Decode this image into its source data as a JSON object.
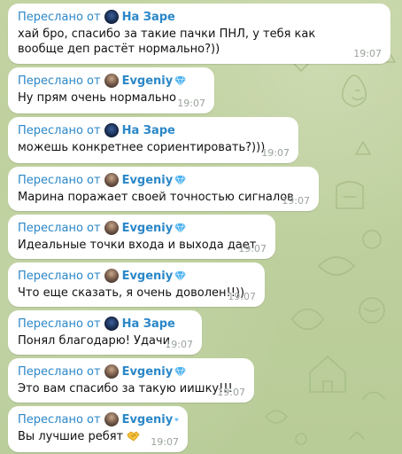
{
  "forward_prefix": "Переслано от",
  "messages": [
    {
      "sender": "На Заре",
      "avatar": "na-zare-avatar",
      "text": "хай бро, спасибо за такие пачки ПНЛ, у тебя как вообще деп растёт нормально?))",
      "time": "19:07"
    },
    {
      "sender": "Evgeniy",
      "avatar": "evgeniy-avatar",
      "text": "Ну прям очень нормально",
      "time": "19:07"
    },
    {
      "sender": "На Заре",
      "avatar": "na-zare-avatar",
      "text": "можешь конкретнее сориентировать?)))",
      "time": "19:07"
    },
    {
      "sender": "Evgeniy",
      "avatar": "evgeniy-avatar",
      "text": "Марина поражает своей точностью сигналов",
      "time": "19:07"
    },
    {
      "sender": "Evgeniy",
      "avatar": "evgeniy-avatar",
      "text": "Идеальные точки входа и выхода дает",
      "time": "19:07"
    },
    {
      "sender": "Evgeniy",
      "avatar": "evgeniy-avatar",
      "text": "Что еще сказать, я очень доволен!!))",
      "time": "19:07"
    },
    {
      "sender": "На Заре",
      "avatar": "na-zare-avatar",
      "text": "Понял благодарю! Удачи",
      "time": "19:07"
    },
    {
      "sender": "Evgeniy",
      "avatar": "evgeniy-avatar",
      "text": "Это вам спасибо за такую иишку!!!",
      "time": "19:07"
    },
    {
      "sender": "Evgeniy",
      "avatar": "evgeniy-avatar",
      "text": "Вы лучшие ребят",
      "time": "19:07",
      "emoji": "handshake-emoji"
    }
  ],
  "colors": {
    "background": "#bccf9c",
    "bubble": "#ffffff",
    "forward_link": "#2b87c8",
    "timestamp": "#9aa39a",
    "premium_badge": "#4fb3f0"
  }
}
